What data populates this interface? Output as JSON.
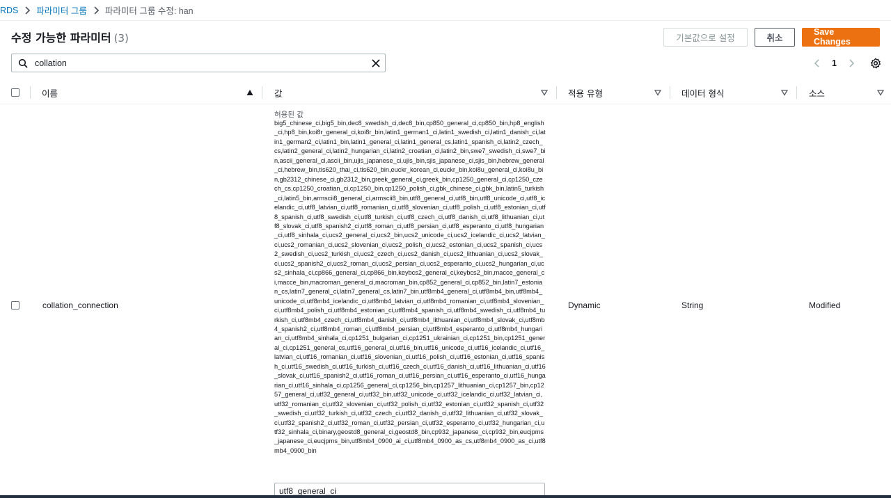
{
  "breadcrumb": {
    "items": [
      "RDS",
      "파라미터 그룹"
    ],
    "current": "파라미터 그룹 수정: han"
  },
  "header": {
    "title": "수정 가능한 파라미터",
    "count": "(3)",
    "reset_label": "기본값으로 설정",
    "cancel_label": "취소",
    "save_label": "Save Changes"
  },
  "search": {
    "value": "collation"
  },
  "pagination": {
    "page": "1"
  },
  "table": {
    "columns": [
      "이름",
      "값",
      "적용 유형",
      "데이터 형식",
      "소스"
    ],
    "rows": [
      {
        "name": "collation_connection",
        "allowed_label": "허용된 값",
        "allowed_values": "big5_chinese_ci,big5_bin,dec8_swedish_ci,dec8_bin,cp850_general_ci,cp850_bin,hp8_english_ci,hp8_bin,koi8r_general_ci,koi8r_bin,latin1_german1_ci,latin1_swedish_ci,latin1_danish_ci,latin1_german2_ci,latin1_bin,latin1_general_ci,latin1_general_cs,latin1_spanish_ci,latin2_czech_cs,latin2_general_ci,latin2_hungarian_ci,latin2_croatian_ci,latin2_bin,swe7_swedish_ci,swe7_bin,ascii_general_ci,ascii_bin,ujis_japanese_ci,ujis_bin,sjis_japanese_ci,sjis_bin,hebrew_general_ci,hebrew_bin,tis620_thai_ci,tis620_bin,euckr_korean_ci,euckr_bin,koi8u_general_ci,koi8u_bin,gb2312_chinese_ci,gb2312_bin,greek_general_ci,greek_bin,cp1250_general_ci,cp1250_czech_cs,cp1250_croatian_ci,cp1250_bin,cp1250_polish_ci,gbk_chinese_ci,gbk_bin,latin5_turkish_ci,latin5_bin,armscii8_general_ci,armscii8_bin,utf8_general_ci,utf8_bin,utf8_unicode_ci,utf8_icelandic_ci,utf8_latvian_ci,utf8_romanian_ci,utf8_slovenian_ci,utf8_polish_ci,utf8_estonian_ci,utf8_spanish_ci,utf8_swedish_ci,utf8_turkish_ci,utf8_czech_ci,utf8_danish_ci,utf8_lithuanian_ci,utf8_slovak_ci,utf8_spanish2_ci,utf8_roman_ci,utf8_persian_ci,utf8_esperanto_ci,utf8_hungarian_ci,utf8_sinhala_ci,ucs2_general_ci,ucs2_bin,ucs2_unicode_ci,ucs2_icelandic_ci,ucs2_latvian_ci,ucs2_romanian_ci,ucs2_slovenian_ci,ucs2_polish_ci,ucs2_estonian_ci,ucs2_spanish_ci,ucs2_swedish_ci,ucs2_turkish_ci,ucs2_czech_ci,ucs2_danish_ci,ucs2_lithuanian_ci,ucs2_slovak_ci,ucs2_spanish2_ci,ucs2_roman_ci,ucs2_persian_ci,ucs2_esperanto_ci,ucs2_hungarian_ci,ucs2_sinhala_ci,cp866_general_ci,cp866_bin,keybcs2_general_ci,keybcs2_bin,macce_general_ci,macce_bin,macroman_general_ci,macroman_bin,cp852_general_ci,cp852_bin,latin7_estonian_cs,latin7_general_ci,latin7_general_cs,latin7_bin,utf8mb4_general_ci,utf8mb4_bin,utf8mb4_unicode_ci,utf8mb4_icelandic_ci,utf8mb4_latvian_ci,utf8mb4_romanian_ci,utf8mb4_slovenian_ci,utf8mb4_polish_ci,utf8mb4_estonian_ci,utf8mb4_spanish_ci,utf8mb4_swedish_ci,utf8mb4_turkish_ci,utf8mb4_czech_ci,utf8mb4_danish_ci,utf8mb4_lithuanian_ci,utf8mb4_slovak_ci,utf8mb4_spanish2_ci,utf8mb4_roman_ci,utf8mb4_persian_ci,utf8mb4_esperanto_ci,utf8mb4_hungarian_ci,utf8mb4_sinhala_ci,cp1251_bulgarian_ci,cp1251_ukrainian_ci,cp1251_bin,cp1251_general_ci,cp1251_general_cs,utf16_general_ci,utf16_bin,utf16_unicode_ci,utf16_icelandic_ci,utf16_latvian_ci,utf16_romanian_ci,utf16_slovenian_ci,utf16_polish_ci,utf16_estonian_ci,utf16_spanish_ci,utf16_swedish_ci,utf16_turkish_ci,utf16_czech_ci,utf16_danish_ci,utf16_lithuanian_ci,utf16_slovak_ci,utf16_spanish2_ci,utf16_roman_ci,utf16_persian_ci,utf16_esperanto_ci,utf16_hungarian_ci,utf16_sinhala_ci,cp1256_general_ci,cp1256_bin,cp1257_lithuanian_ci,cp1257_bin,cp1257_general_ci,utf32_general_ci,utf32_bin,utf32_unicode_ci,utf32_icelandic_ci,utf32_latvian_ci,utf32_romanian_ci,utf32_slovenian_ci,utf32_polish_ci,utf32_estonian_ci,utf32_spanish_ci,utf32_swedish_ci,utf32_turkish_ci,utf32_czech_ci,utf32_danish_ci,utf32_lithuanian_ci,utf32_slovak_ci,utf32_spanish2_ci,utf32_roman_ci,utf32_persian_ci,utf32_esperanto_ci,utf32_hungarian_ci,utf32_sinhala_ci,binary,geostd8_general_ci,geostd8_bin,cp932_japanese_ci,cp932_bin,eucjpms_japanese_ci,eucjpms_bin,utf8mb4_0900_ai_ci,utf8mb4_0900_as_cs,utf8mb4_0900_as_ci,utf8mb4_0900_bin",
        "value": "utf8_general_ci",
        "apply_type": "Dynamic",
        "data_type": "String",
        "source": "Modified"
      }
    ]
  },
  "colors": {
    "link": "#0073bb",
    "primary": "#ec7211",
    "border": "#aab7b8",
    "footer": "#232f3e"
  }
}
